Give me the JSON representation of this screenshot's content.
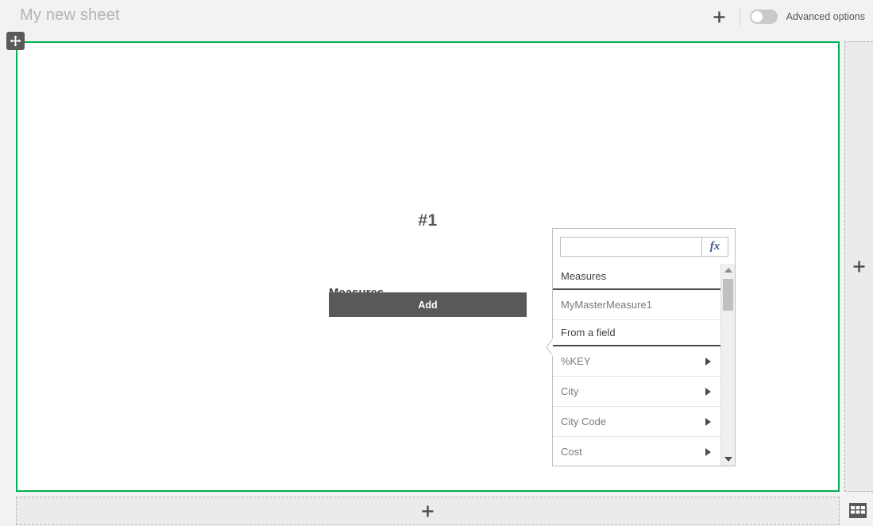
{
  "topbar": {
    "sheet_title": "My new sheet",
    "add_icon": "plus-icon",
    "advanced_options_label": "Advanced options",
    "advanced_options_state": "off"
  },
  "canvas": {
    "move_handle_icon": "move-icon",
    "border_color": "#00b055",
    "chart": {
      "number": "#1",
      "measures_label": "Measures",
      "add_button_label": "Add",
      "add_button_color": "#595959"
    }
  },
  "popup": {
    "search_value": "",
    "search_placeholder": "",
    "expression_button_label": "fx",
    "sections": [
      {
        "header": "Measures",
        "items": [
          {
            "label": "MyMasterMeasure1",
            "has_arrow": false
          }
        ]
      },
      {
        "header": "From a field",
        "items": [
          {
            "label": "%KEY",
            "has_arrow": true
          },
          {
            "label": "City",
            "has_arrow": true
          },
          {
            "label": "City Code",
            "has_arrow": true
          },
          {
            "label": "Cost",
            "has_arrow": true
          }
        ]
      }
    ],
    "scrollbar": {
      "up_icon": "triangle-up-icon",
      "down_icon": "triangle-down-icon"
    }
  },
  "dropzones": {
    "right_label": "+",
    "bottom_label": "+"
  },
  "footer": {
    "grid_icon": "grid-table-icon"
  }
}
